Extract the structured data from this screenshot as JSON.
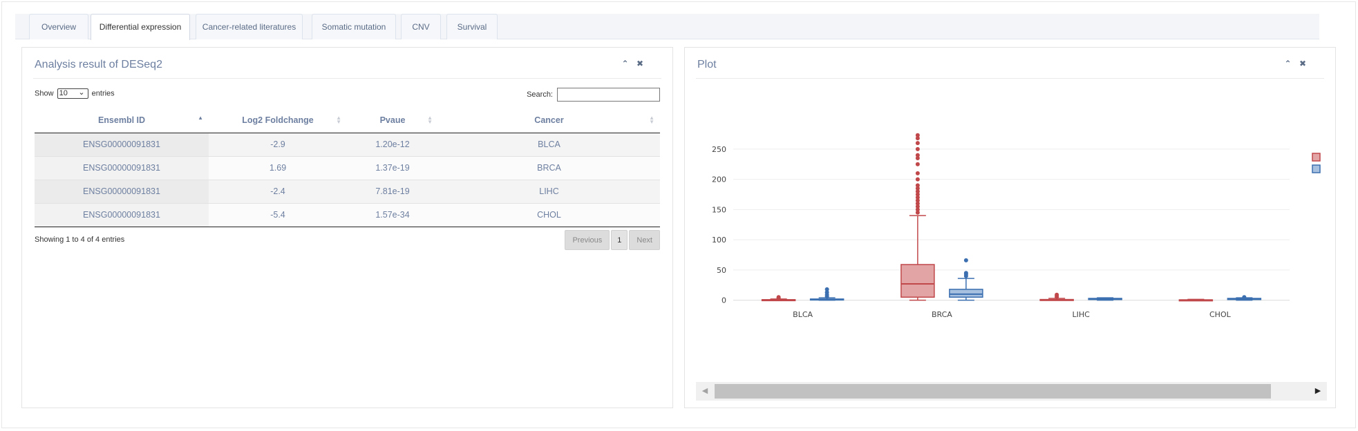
{
  "tabs": [
    {
      "label": "Overview",
      "active": false
    },
    {
      "label": "Differential expression",
      "active": true
    },
    {
      "label": "Cancer-related literatures",
      "active": false
    },
    {
      "label": "Somatic mutation",
      "active": false
    },
    {
      "label": "CNV",
      "active": false
    },
    {
      "label": "Survival",
      "active": false
    }
  ],
  "left_panel": {
    "title": "Analysis result of DESeq2",
    "collapse_icon": "chevron-up-icon",
    "close_icon": "close-icon",
    "show_label_before": "Show",
    "show_value": "10",
    "show_label_after": "entries",
    "search_label": "Search:",
    "search_value": "",
    "columns": [
      "Ensembl ID",
      "Log2 Foldchange",
      "Pvaue",
      "Cancer"
    ],
    "rows": [
      {
        "ensembl_id": "ENSG00000091831",
        "log2fc": "-2.9",
        "pvalue": "1.20e-12",
        "cancer": "BLCA"
      },
      {
        "ensembl_id": "ENSG00000091831",
        "log2fc": "1.69",
        "pvalue": "1.37e-19",
        "cancer": "BRCA"
      },
      {
        "ensembl_id": "ENSG00000091831",
        "log2fc": "-2.4",
        "pvalue": "7.81e-19",
        "cancer": "LIHC"
      },
      {
        "ensembl_id": "ENSG00000091831",
        "log2fc": "-5.4",
        "pvalue": "1.57e-34",
        "cancer": "CHOL"
      }
    ],
    "info_text": "Showing 1 to 4 of 4 entries",
    "pager": {
      "previous": "Previous",
      "current": "1",
      "next": "Next"
    }
  },
  "right_panel": {
    "title": "Plot",
    "collapse_icon": "chevron-up-icon",
    "close_icon": "close-icon",
    "scroll_left_icon": "triangle-left-icon",
    "scroll_right_icon": "triangle-right-icon"
  },
  "chart_data": {
    "type": "box",
    "categories": [
      "BLCA",
      "BRCA",
      "LIHC",
      "CHOL"
    ],
    "yticks": [
      0,
      50,
      100,
      150,
      200,
      250
    ],
    "ylim": [
      -5,
      275
    ],
    "grid": true,
    "legend": "top-right",
    "series": [
      {
        "color": "#c0474a",
        "fill": "#e3a4a5",
        "boxes": [
          {
            "min": 0,
            "q1": 0.1,
            "median": 0.4,
            "q3": 0.9,
            "max": 2,
            "outliers": [
              3,
              4,
              5
            ]
          },
          {
            "min": 0,
            "q1": 5,
            "median": 27,
            "q3": 59,
            "max": 140,
            "outliers": [
              145,
              150,
              155,
              160,
              165,
              170,
              175,
              180,
              185,
              190,
              200,
              210,
              225,
              235,
              240,
              250,
              260,
              268,
              273
            ]
          },
          {
            "min": 0,
            "q1": 0.2,
            "median": 0.6,
            "q3": 1.2,
            "max": 3,
            "outliers": [
              5,
              7,
              9
            ]
          },
          {
            "min": 0,
            "q1": 0.1,
            "median": 0.3,
            "q3": 0.6,
            "max": 1.5,
            "outliers": []
          }
        ]
      },
      {
        "color": "#3b6fb0",
        "fill": "#a7c0e0",
        "boxes": [
          {
            "min": 0,
            "q1": 0.3,
            "median": 0.9,
            "q3": 2,
            "max": 4,
            "outliers": [
              6,
              9,
              13,
              18
            ]
          },
          {
            "min": 0,
            "q1": 5,
            "median": 10,
            "q3": 18,
            "max": 36,
            "outliers": [
              40,
              43,
              45,
              66
            ]
          },
          {
            "min": 0,
            "q1": 1,
            "median": 2,
            "q3": 3,
            "max": 4,
            "outliers": []
          },
          {
            "min": 0,
            "q1": 1,
            "median": 2,
            "q3": 3,
            "max": 4,
            "outliers": [
              5
            ]
          }
        ]
      }
    ]
  }
}
